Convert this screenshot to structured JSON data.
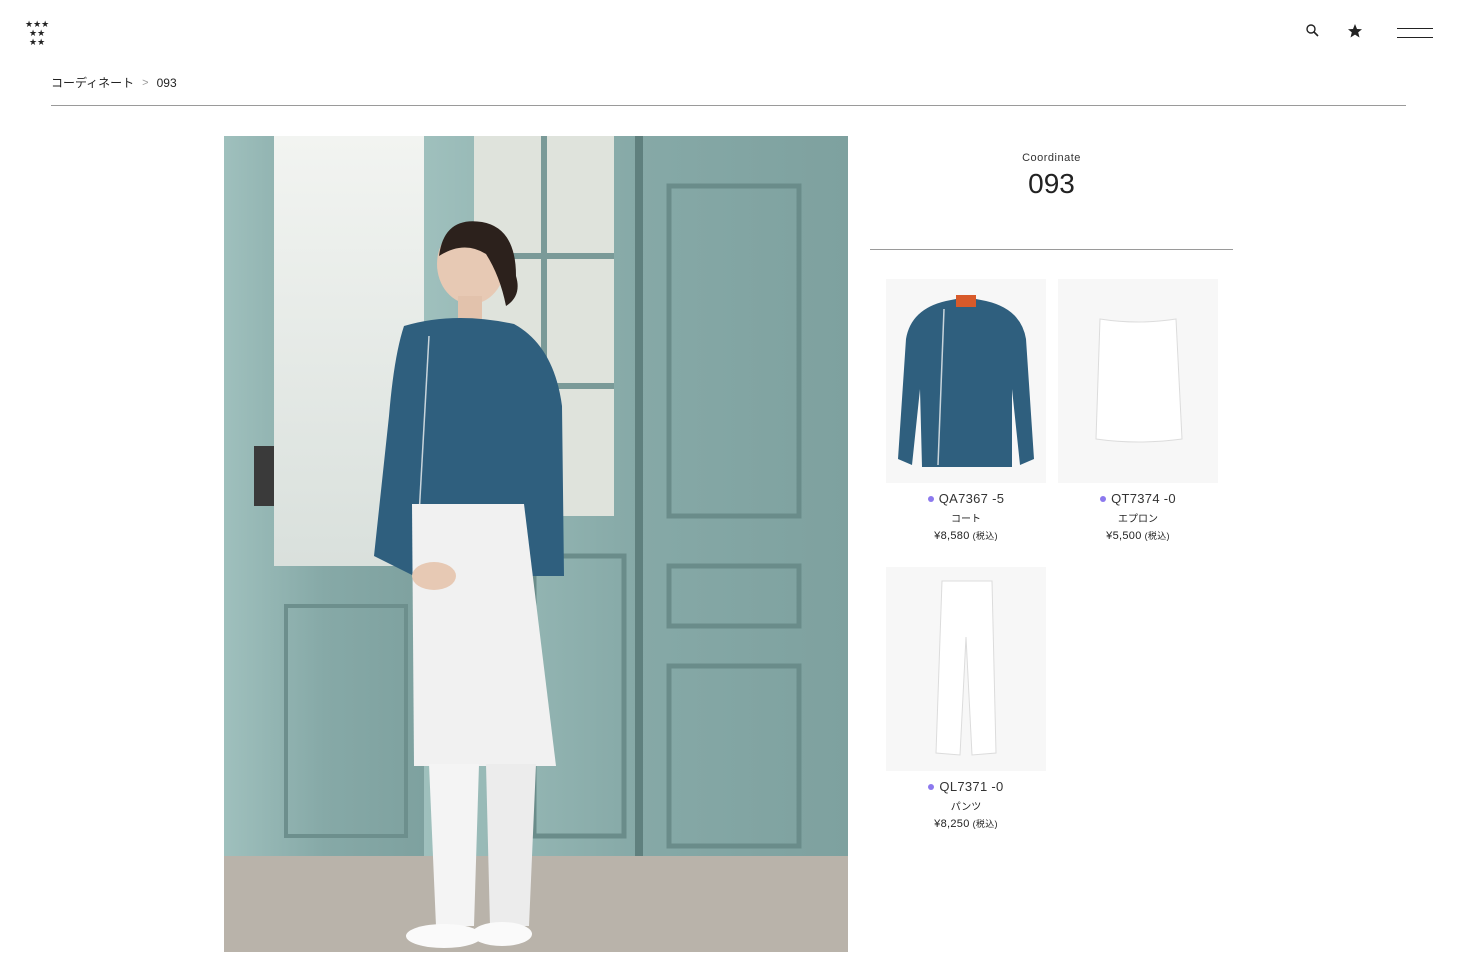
{
  "header": {
    "logo_icon": "five-stars-logo",
    "search_icon": "search-icon",
    "favorite_icon": "star-icon",
    "menu_icon": "hamburger-menu-icon"
  },
  "breadcrumb": {
    "parent": "コーディネート",
    "separator": ">",
    "current": "093"
  },
  "coordinate": {
    "label": "Coordinate",
    "number": "093"
  },
  "products": [
    {
      "code": "QA7367 -5",
      "name": "コート",
      "price": "¥8,580",
      "tax": "(税込)",
      "color_dot": "#8c79ee",
      "garment_color": "#2f5f7e"
    },
    {
      "code": "QT7374 -0",
      "name": "エプロン",
      "price": "¥5,500",
      "tax": "(税込)",
      "color_dot": "#8c79ee",
      "garment_color": "#ffffff"
    },
    {
      "code": "QL7371 -0",
      "name": "パンツ",
      "price": "¥8,250",
      "tax": "(税込)",
      "color_dot": "#8c79ee",
      "garment_color": "#ffffff"
    }
  ],
  "colors": {
    "text": "#222222",
    "rule": "#9a9a9a",
    "accent_dot": "#8c79ee",
    "door": "#8fb0ae",
    "jacket": "#2f5f7e"
  }
}
